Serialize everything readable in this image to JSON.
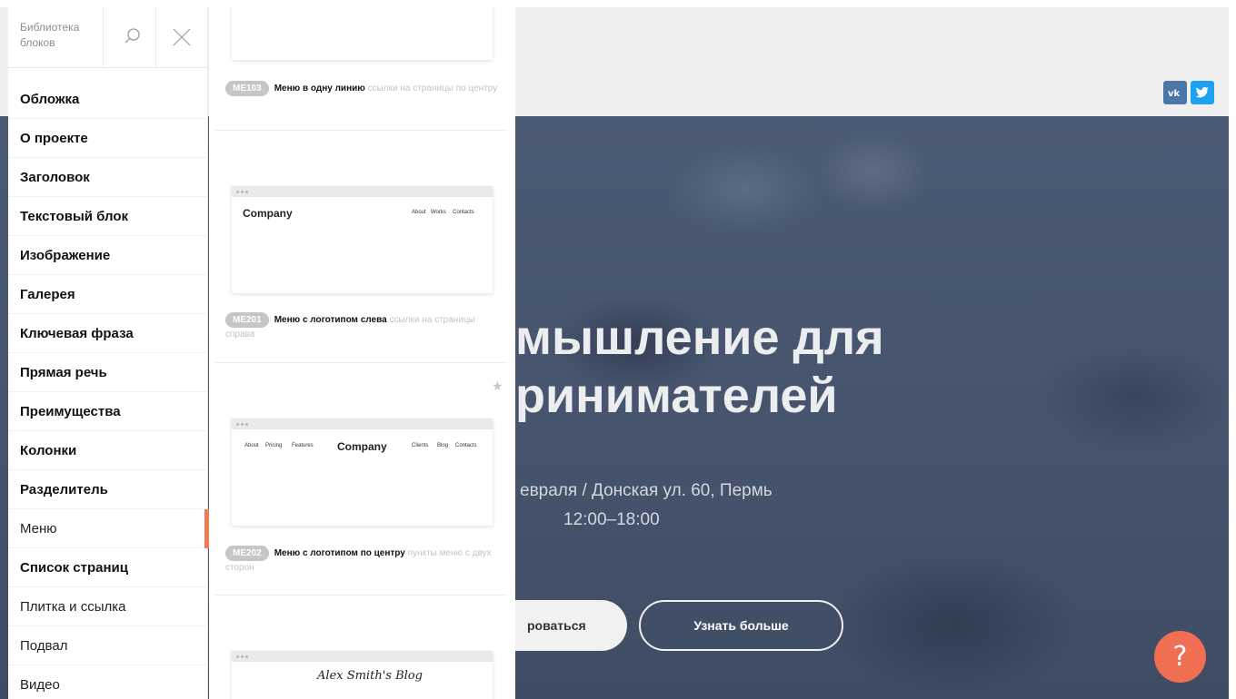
{
  "sidebar": {
    "title": "Библиотека блоков",
    "search_icon": "search-icon",
    "close_icon": "close-icon",
    "accent_color": "#f07c55",
    "items": [
      {
        "label": "Обложка"
      },
      {
        "label": "О проекте"
      },
      {
        "label": "Заголовок"
      },
      {
        "label": "Текстовый блок"
      },
      {
        "label": "Изображение"
      },
      {
        "label": "Галерея"
      },
      {
        "label": "Ключевая фраза"
      },
      {
        "label": "Прямая речь"
      },
      {
        "label": "Преимущества"
      },
      {
        "label": "Колонки"
      },
      {
        "label": "Разделитель"
      },
      {
        "label": "Меню",
        "active": true
      },
      {
        "label": "Список страниц"
      },
      {
        "label": "Плитка и ссылка"
      },
      {
        "label": "Подвал"
      },
      {
        "label": "Видео"
      }
    ]
  },
  "library": {
    "blocks": [
      {
        "code": "ME103",
        "name": "Меню в одну линию",
        "description": "ссылки на страницы по центру"
      },
      {
        "code": "ME201",
        "name": "Меню с логотипом слева",
        "description": "ссылки на страницы справа",
        "thumb": {
          "brand": "Company",
          "links": [
            "About",
            "Works",
            "Contacts"
          ]
        }
      },
      {
        "code": "ME202",
        "name": "Меню с логотипом по центру",
        "description": "пункты меню с двух сторон",
        "thumb": {
          "brand": "Company",
          "left_links": [
            "About",
            "Pricing",
            "Features"
          ],
          "right_links": [
            "Clients",
            "Blog",
            "Contacts"
          ]
        }
      },
      {
        "thumb": {
          "brand": "Alex Smith's Blog"
        }
      }
    ]
  },
  "preview": {
    "social": [
      {
        "icon": "vk-icon",
        "label": "ĸ",
        "color": "#4a76a8"
      },
      {
        "icon": "twitter-icon",
        "label": "t",
        "color": "#1da1f2"
      }
    ],
    "hero": {
      "title_line1": "мышление для",
      "title_line2": "ринимателей",
      "date_place": "евраля / Донская ул. 60, Пермь",
      "time": "12:00–18:00",
      "primary_button": "роваться",
      "secondary_button": "Узнать больше"
    },
    "help_label": "?",
    "help_color": "#f06e52"
  }
}
